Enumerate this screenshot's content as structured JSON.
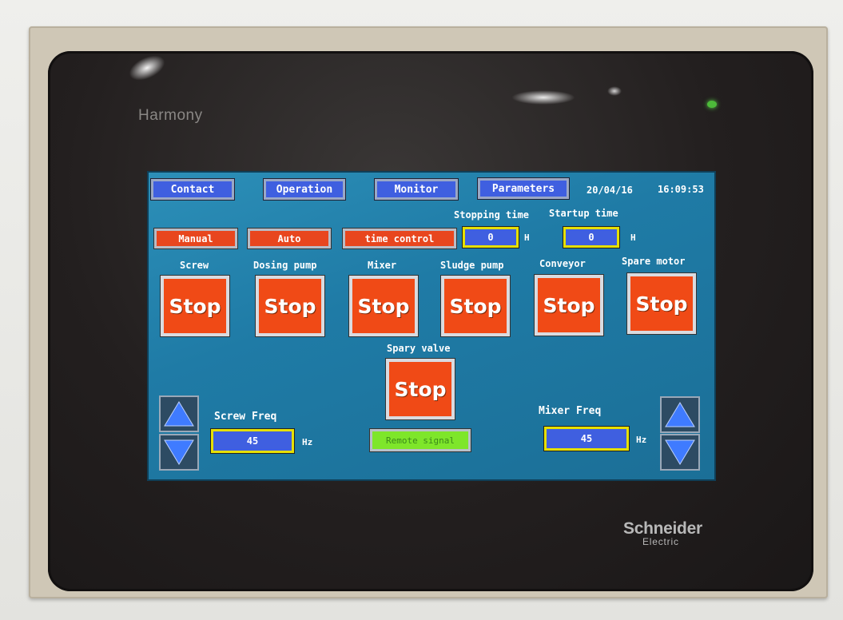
{
  "device": {
    "brand": "Harmony",
    "manufacturer": "Schneider",
    "manufacturer_sub": "Electric"
  },
  "nav": {
    "contact": "Contact",
    "operation": "Operation",
    "monitor": "Monitor",
    "parameters": "Parameters"
  },
  "status": {
    "date": "20/04/16",
    "time": "16:09:53"
  },
  "modes": {
    "manual": "Manual",
    "auto": "Auto",
    "time_control": "time control"
  },
  "timers": {
    "stopping_label": "Stopping time",
    "stopping_value": "0",
    "stopping_unit": "H",
    "startup_label": "Startup time",
    "startup_value": "0",
    "startup_unit": "H"
  },
  "motors": [
    {
      "label": "Screw",
      "state": "Stop"
    },
    {
      "label": "Dosing pump",
      "state": "Stop"
    },
    {
      "label": "Mixer",
      "state": "Stop"
    },
    {
      "label": "Sludge pump",
      "state": "Stop"
    },
    {
      "label": "Conveyor",
      "state": "Stop"
    },
    {
      "label": "Spare motor",
      "state": "Stop"
    }
  ],
  "valve": {
    "label": "Spary valve",
    "state": "Stop"
  },
  "remote_signal": "Remote signal",
  "screw_freq": {
    "label": "Screw Freq",
    "value": "45",
    "unit": "Hz"
  },
  "mixer_freq": {
    "label": "Mixer Freq",
    "value": "45",
    "unit": "Hz"
  },
  "colors": {
    "screen_bg": "#1f7ba6",
    "stop_button": "#f04a16",
    "nav_button": "#3f5fe0",
    "field_border": "#e6e000",
    "remote_signal": "#7ee62a"
  }
}
